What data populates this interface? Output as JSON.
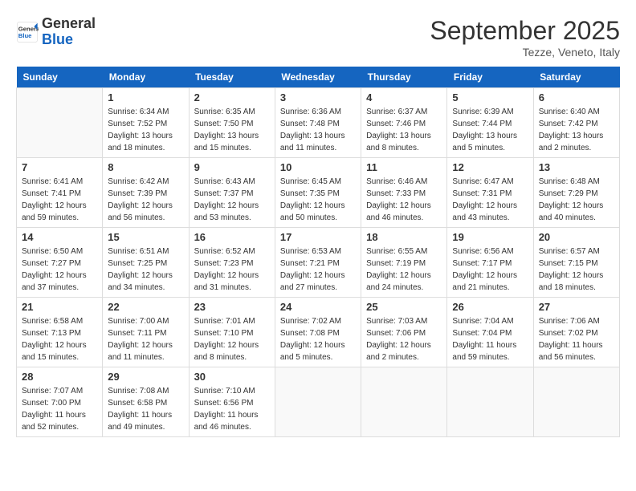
{
  "header": {
    "logo_general": "General",
    "logo_blue": "Blue",
    "month": "September 2025",
    "location": "Tezze, Veneto, Italy"
  },
  "days_of_week": [
    "Sunday",
    "Monday",
    "Tuesday",
    "Wednesday",
    "Thursday",
    "Friday",
    "Saturday"
  ],
  "weeks": [
    [
      {
        "day": "",
        "info": ""
      },
      {
        "day": "1",
        "info": "Sunrise: 6:34 AM\nSunset: 7:52 PM\nDaylight: 13 hours\nand 18 minutes."
      },
      {
        "day": "2",
        "info": "Sunrise: 6:35 AM\nSunset: 7:50 PM\nDaylight: 13 hours\nand 15 minutes."
      },
      {
        "day": "3",
        "info": "Sunrise: 6:36 AM\nSunset: 7:48 PM\nDaylight: 13 hours\nand 11 minutes."
      },
      {
        "day": "4",
        "info": "Sunrise: 6:37 AM\nSunset: 7:46 PM\nDaylight: 13 hours\nand 8 minutes."
      },
      {
        "day": "5",
        "info": "Sunrise: 6:39 AM\nSunset: 7:44 PM\nDaylight: 13 hours\nand 5 minutes."
      },
      {
        "day": "6",
        "info": "Sunrise: 6:40 AM\nSunset: 7:42 PM\nDaylight: 13 hours\nand 2 minutes."
      }
    ],
    [
      {
        "day": "7",
        "info": "Sunrise: 6:41 AM\nSunset: 7:41 PM\nDaylight: 12 hours\nand 59 minutes."
      },
      {
        "day": "8",
        "info": "Sunrise: 6:42 AM\nSunset: 7:39 PM\nDaylight: 12 hours\nand 56 minutes."
      },
      {
        "day": "9",
        "info": "Sunrise: 6:43 AM\nSunset: 7:37 PM\nDaylight: 12 hours\nand 53 minutes."
      },
      {
        "day": "10",
        "info": "Sunrise: 6:45 AM\nSunset: 7:35 PM\nDaylight: 12 hours\nand 50 minutes."
      },
      {
        "day": "11",
        "info": "Sunrise: 6:46 AM\nSunset: 7:33 PM\nDaylight: 12 hours\nand 46 minutes."
      },
      {
        "day": "12",
        "info": "Sunrise: 6:47 AM\nSunset: 7:31 PM\nDaylight: 12 hours\nand 43 minutes."
      },
      {
        "day": "13",
        "info": "Sunrise: 6:48 AM\nSunset: 7:29 PM\nDaylight: 12 hours\nand 40 minutes."
      }
    ],
    [
      {
        "day": "14",
        "info": "Sunrise: 6:50 AM\nSunset: 7:27 PM\nDaylight: 12 hours\nand 37 minutes."
      },
      {
        "day": "15",
        "info": "Sunrise: 6:51 AM\nSunset: 7:25 PM\nDaylight: 12 hours\nand 34 minutes."
      },
      {
        "day": "16",
        "info": "Sunrise: 6:52 AM\nSunset: 7:23 PM\nDaylight: 12 hours\nand 31 minutes."
      },
      {
        "day": "17",
        "info": "Sunrise: 6:53 AM\nSunset: 7:21 PM\nDaylight: 12 hours\nand 27 minutes."
      },
      {
        "day": "18",
        "info": "Sunrise: 6:55 AM\nSunset: 7:19 PM\nDaylight: 12 hours\nand 24 minutes."
      },
      {
        "day": "19",
        "info": "Sunrise: 6:56 AM\nSunset: 7:17 PM\nDaylight: 12 hours\nand 21 minutes."
      },
      {
        "day": "20",
        "info": "Sunrise: 6:57 AM\nSunset: 7:15 PM\nDaylight: 12 hours\nand 18 minutes."
      }
    ],
    [
      {
        "day": "21",
        "info": "Sunrise: 6:58 AM\nSunset: 7:13 PM\nDaylight: 12 hours\nand 15 minutes."
      },
      {
        "day": "22",
        "info": "Sunrise: 7:00 AM\nSunset: 7:11 PM\nDaylight: 12 hours\nand 11 minutes."
      },
      {
        "day": "23",
        "info": "Sunrise: 7:01 AM\nSunset: 7:10 PM\nDaylight: 12 hours\nand 8 minutes."
      },
      {
        "day": "24",
        "info": "Sunrise: 7:02 AM\nSunset: 7:08 PM\nDaylight: 12 hours\nand 5 minutes."
      },
      {
        "day": "25",
        "info": "Sunrise: 7:03 AM\nSunset: 7:06 PM\nDaylight: 12 hours\nand 2 minutes."
      },
      {
        "day": "26",
        "info": "Sunrise: 7:04 AM\nSunset: 7:04 PM\nDaylight: 11 hours\nand 59 minutes."
      },
      {
        "day": "27",
        "info": "Sunrise: 7:06 AM\nSunset: 7:02 PM\nDaylight: 11 hours\nand 56 minutes."
      }
    ],
    [
      {
        "day": "28",
        "info": "Sunrise: 7:07 AM\nSunset: 7:00 PM\nDaylight: 11 hours\nand 52 minutes."
      },
      {
        "day": "29",
        "info": "Sunrise: 7:08 AM\nSunset: 6:58 PM\nDaylight: 11 hours\nand 49 minutes."
      },
      {
        "day": "30",
        "info": "Sunrise: 7:10 AM\nSunset: 6:56 PM\nDaylight: 11 hours\nand 46 minutes."
      },
      {
        "day": "",
        "info": ""
      },
      {
        "day": "",
        "info": ""
      },
      {
        "day": "",
        "info": ""
      },
      {
        "day": "",
        "info": ""
      }
    ]
  ]
}
